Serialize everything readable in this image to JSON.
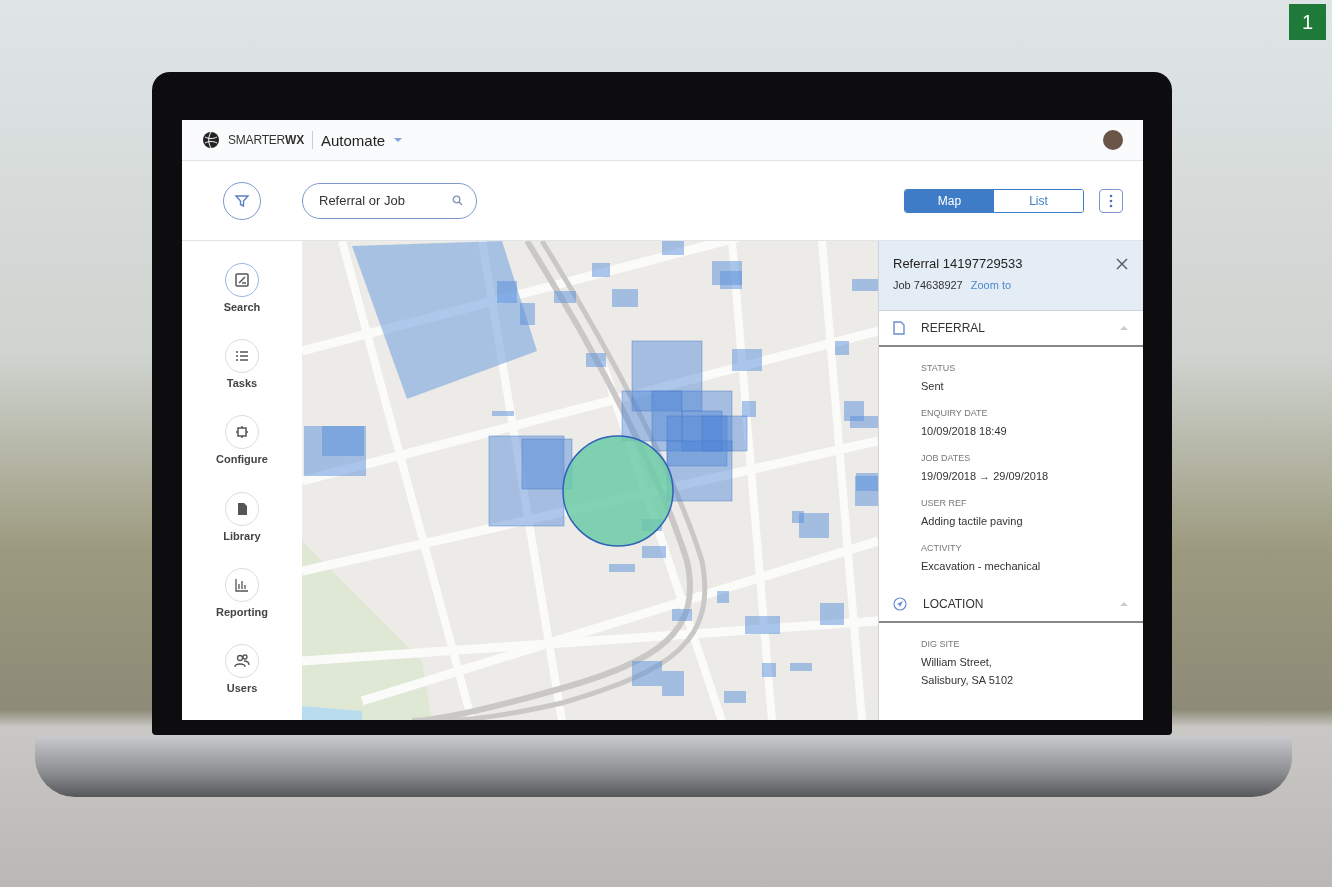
{
  "badge": "1",
  "app": {
    "brand": "SMARTER**WX**",
    "product": "Automate"
  },
  "toolbar": {
    "search": {
      "placeholder": "Referral or Job"
    },
    "view_toggle": [
      {
        "label": "Map",
        "selected": true
      },
      {
        "label": "List",
        "selected": false
      }
    ]
  },
  "sidebar": {
    "items": [
      {
        "label": "Search",
        "selected": true
      },
      {
        "label": "Tasks",
        "selected": false
      },
      {
        "label": "Configure",
        "selected": false
      },
      {
        "label": "Library",
        "selected": false
      },
      {
        "label": "Reporting",
        "selected": false
      },
      {
        "label": "Users",
        "selected": false
      }
    ]
  },
  "details": {
    "title": "Referral 14197729533",
    "subtitle": "Job 74638927",
    "link": "Zoom to",
    "sections": [
      {
        "title": "REFERRAL",
        "expanded": true,
        "fields": [
          {
            "label": "STATUS",
            "value": "Sent"
          },
          {
            "label": "ENQUIRY DATE",
            "value": "10/09/2018 18:49"
          },
          {
            "label": "JOB DATES",
            "value": "19/09/2018 → 29/09/2018"
          },
          {
            "label": "USER REF",
            "value": "Adding tactile paving"
          },
          {
            "label": "ACTIVITY",
            "value": "Excavation - mechanical"
          }
        ]
      },
      {
        "title": "LOCATION",
        "expanded": true,
        "fields": [
          {
            "label": "DIG SITE",
            "value": "William Street,\nSalisbury, SA 5102"
          }
        ]
      }
    ]
  }
}
